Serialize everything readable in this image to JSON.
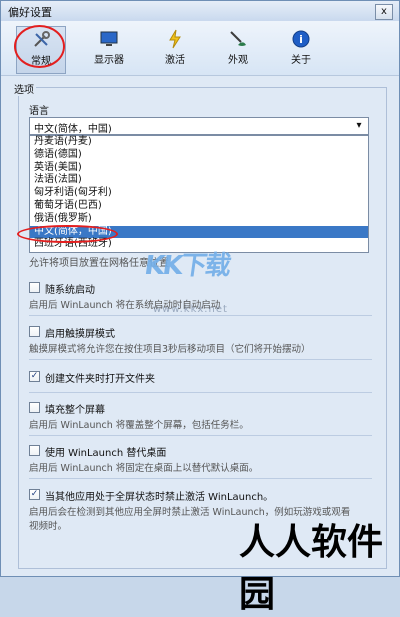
{
  "window": {
    "title": "偏好设置",
    "close_glyph": "x"
  },
  "toolbar": {
    "items": [
      {
        "label": "常规",
        "icon": "tools-icon"
      },
      {
        "label": "显示器",
        "icon": "monitor-icon"
      },
      {
        "label": "激活",
        "icon": "lightning-icon"
      },
      {
        "label": "外观",
        "icon": "brush-icon"
      },
      {
        "label": "关于",
        "icon": "info-icon"
      }
    ]
  },
  "group": {
    "title": "选项"
  },
  "language": {
    "label": "语言",
    "selected": "中文(简体，中国)",
    "options": [
      "丹麦语(丹麦)",
      "德语(德国)",
      "英语(美国)",
      "法语(法国)",
      "匈牙利语(匈牙利)",
      "葡萄牙语(巴西)",
      "俄语(俄罗斯)",
      "中文(简体，中国)",
      "西班牙语(西班牙)"
    ],
    "selected_index": 7
  },
  "hint": "允许将项目放置在网格任意位置",
  "options": [
    {
      "label": "随系统启动",
      "desc": "启用后 WinLaunch 将在系统启动时自动启动",
      "checked": false
    },
    {
      "label": "启用触摸屏模式",
      "desc": "触摸屏模式将允许您在按住项目3秒后移动项目（它们将开始摆动）",
      "checked": false
    },
    {
      "label": "创建文件夹时打开文件夹",
      "desc": "",
      "checked": true
    },
    {
      "label": "填充整个屏幕",
      "desc": "启用后 WinLaunch 将覆盖整个屏幕，包括任务栏。",
      "checked": false
    },
    {
      "label": "使用 WinLaunch 替代桌面",
      "desc": "启用后 WinLaunch 将固定在桌面上以替代默认桌面。",
      "checked": false
    },
    {
      "label": "当其他应用处于全屏状态时禁止激活 WinLaunch。",
      "desc": "启用后会在检测到其他应用全屏时禁止激活 WinLaunch，例如玩游戏或观看视频时。",
      "checked": true
    }
  ],
  "watermarks": {
    "site": "KK下载",
    "url": "www.kkx.net",
    "brand": "人人软件园"
  },
  "colors": {
    "selection": "#3a78c6",
    "highlight_ring": "#e31f1f"
  }
}
